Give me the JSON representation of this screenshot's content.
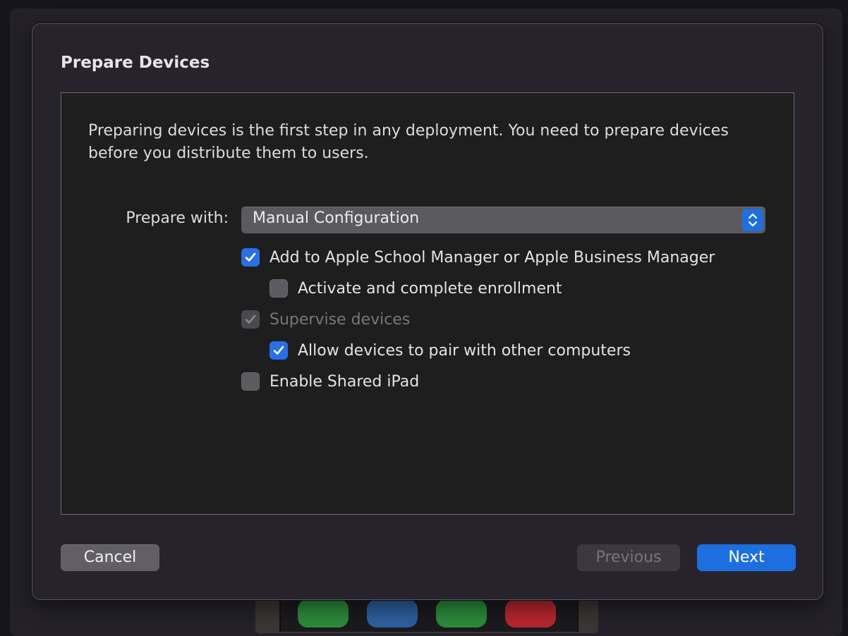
{
  "dialog": {
    "title": "Prepare Devices",
    "description": "Preparing devices is the first step in any deployment. You need to prepare devices before you distribute them to users.",
    "prepare_with_label": "Prepare with:",
    "prepare_with_value": "Manual Configuration",
    "options": [
      {
        "label": "Add to Apple School Manager or Apple Business Manager",
        "checked": true,
        "enabled": true
      },
      {
        "label": "Activate and complete enrollment",
        "checked": false,
        "enabled": true
      },
      {
        "label": "Supervise devices",
        "checked": true,
        "enabled": false
      },
      {
        "label": "Allow devices to pair with other computers",
        "checked": true,
        "enabled": true
      },
      {
        "label": "Enable Shared iPad",
        "checked": false,
        "enabled": true
      }
    ],
    "buttons": {
      "cancel": "Cancel",
      "previous": "Previous",
      "next": "Next"
    }
  },
  "colors": {
    "accent": "#1d6fe0",
    "panel": "#1e1e1e",
    "sheet": "#27232d"
  }
}
